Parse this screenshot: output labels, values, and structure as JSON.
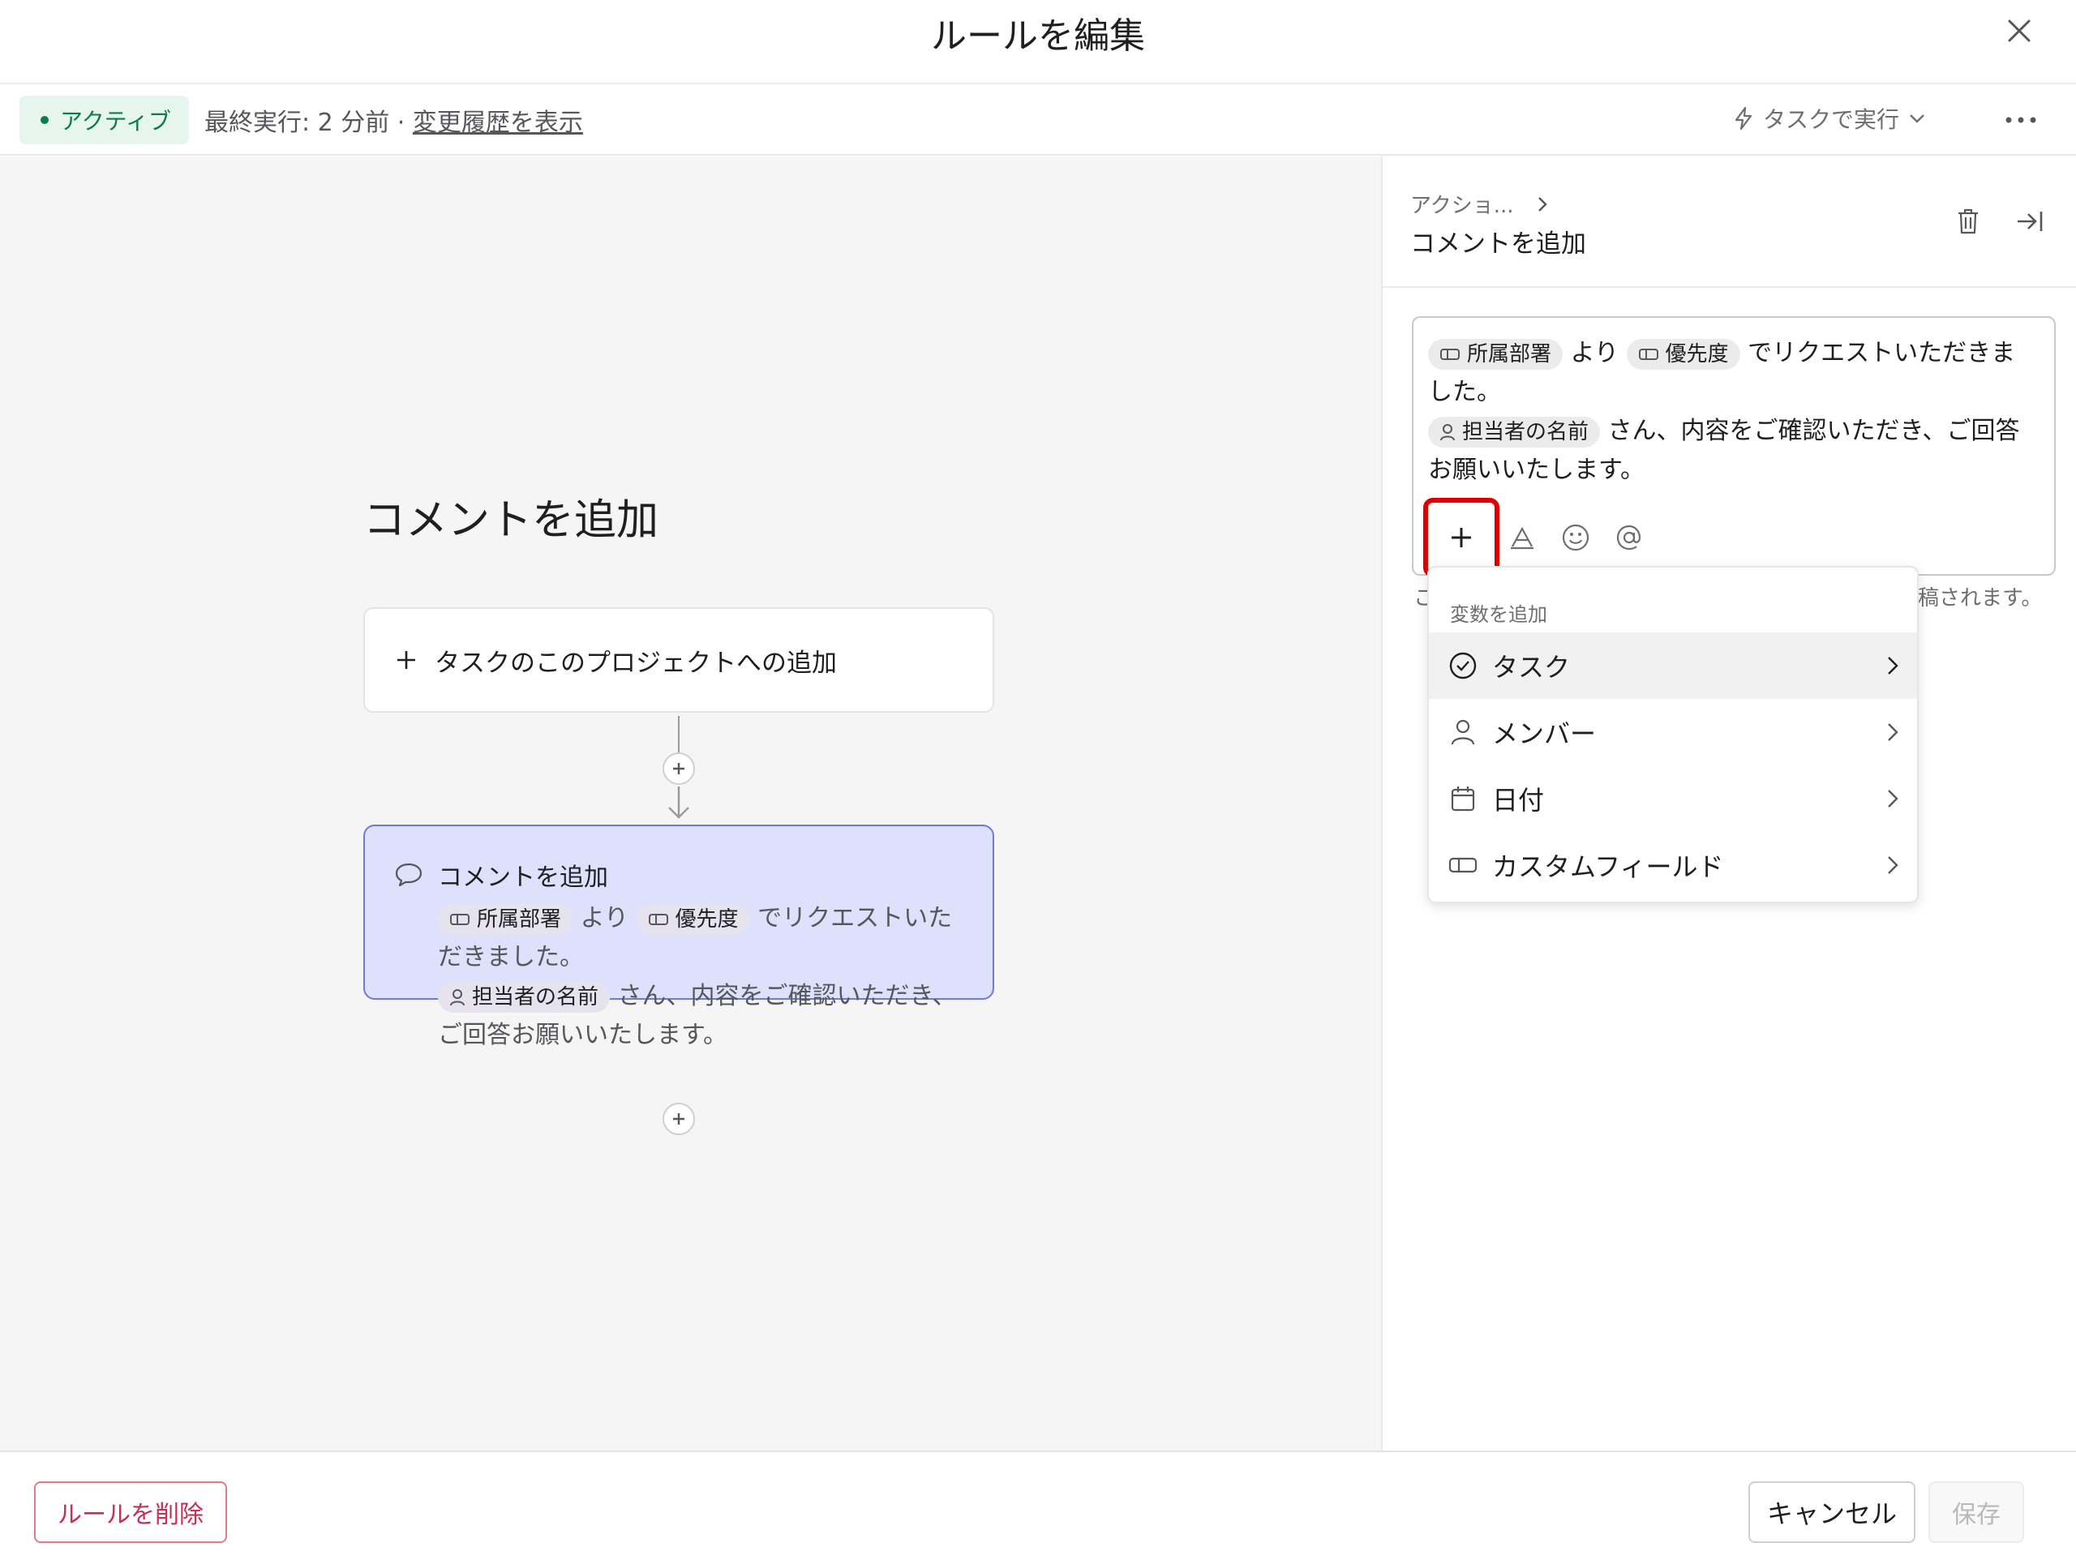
{
  "header": {
    "title": "ルールを編集"
  },
  "subbar": {
    "status": "アクティブ",
    "last_run": "最終実行: 2 分前 ·",
    "history_link": "変更履歴を表示",
    "run_on": "タスクで実行"
  },
  "canvas": {
    "title": "コメントを追加",
    "trigger_label": "タスクのこのプロジェクトへの追加",
    "action": {
      "title": "コメントを追加",
      "chip_department": "所属部署",
      "text_from": "より",
      "chip_priority": "優先度",
      "text_request": "でリクエストいただきました。",
      "chip_assignee": "担当者の名前",
      "text_confirm": "さん、内容をご確認いただき、ご回答お願いいたします。"
    }
  },
  "panel": {
    "breadcrumb": "アクショ...",
    "title": "コメントを追加",
    "editor": {
      "chip_department": "所属部署",
      "text_from": "より",
      "chip_priority": "優先度",
      "text_request": "でリクエストいただきました。",
      "chip_assignee": "担当者の名前",
      "text_confirm": "さん、内容をご確認いただき、ご回答お願いいたします。"
    },
    "helper_start": "こ",
    "helper_end": "稿されます。",
    "dropdown": {
      "title": "変数を追加",
      "items": [
        {
          "label": "タスク",
          "icon": "check-circle-icon"
        },
        {
          "label": "メンバー",
          "icon": "person-icon"
        },
        {
          "label": "日付",
          "icon": "calendar-icon"
        },
        {
          "label": "カスタムフィールド",
          "icon": "custom-field-icon"
        }
      ]
    }
  },
  "footer": {
    "delete_label": "ルールを削除",
    "cancel_label": "キャンセル",
    "save_label": "保存"
  },
  "colors": {
    "accent_red": "#e00000",
    "active_green": "#0d7a50",
    "action_card_bg": "#dde1fb",
    "action_card_border": "#6c7cd6",
    "delete_red": "#c92f54"
  }
}
